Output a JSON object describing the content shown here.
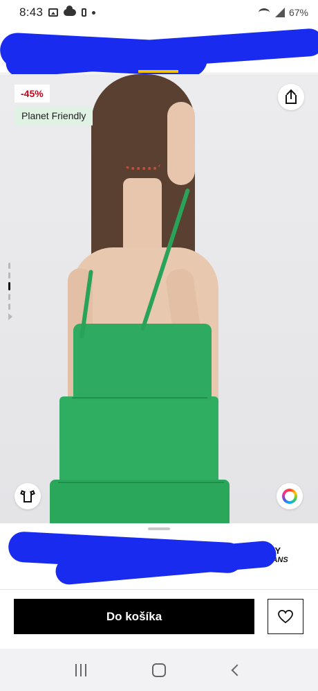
{
  "status_bar": {
    "time": "8:43",
    "battery": "67%",
    "icons": [
      "gallery-icon",
      "cloud-icon",
      "battery-saver-icon",
      "dot-icon",
      "wifi-icon",
      "volte-icon",
      "signal-icon"
    ]
  },
  "product": {
    "discount": "-45%",
    "eco_badge": "Planet Friendly",
    "brand_line1": "TOMMY",
    "brand_line2": "JEANS",
    "dress_color": "#2eab60"
  },
  "actions": {
    "add_to_cart": "Do košíka"
  },
  "colors": {
    "discount_red": "#c7001a",
    "eco_green_bg": "#e0f2e4",
    "accent_yellow": "#f5c400",
    "redaction_blue": "#1a2bf0",
    "cart_button_bg": "#000000"
  },
  "gallery": {
    "images_total": 7,
    "active_image": 3
  }
}
